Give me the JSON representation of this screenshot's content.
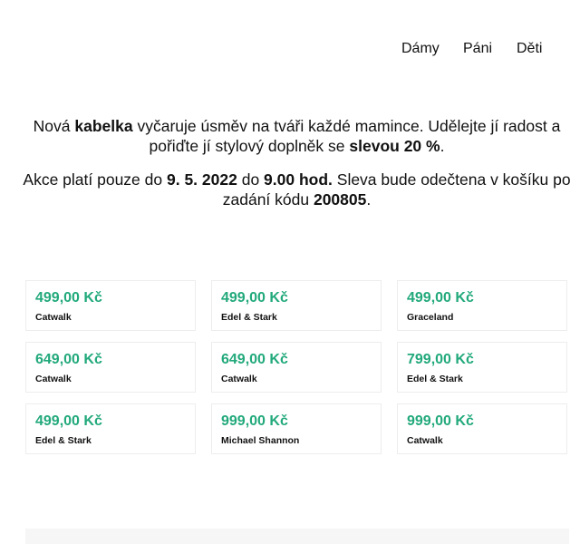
{
  "nav": {
    "items": [
      {
        "label": "Dámy"
      },
      {
        "label": "Páni"
      },
      {
        "label": "Děti"
      }
    ]
  },
  "promo": {
    "p1": {
      "t1": "Nová ",
      "b1": "kabelka",
      "t2": " vyčaruje úsměv na tváři každé mamince. Udělejte jí radost a pořiďte jí stylový doplněk se ",
      "b2": "slevou 20 %",
      "t3": "."
    },
    "p2": {
      "t1": "Akce platí pouze do ",
      "b1": "9. 5. 2022",
      "t2": " do ",
      "b2": "9.00 hod.",
      "t3": " Sleva bude odečtena v košíku po zadání kódu ",
      "b3": "200805",
      "t4": "."
    }
  },
  "products": [
    {
      "price": "499,00 Kč",
      "brand": "Catwalk"
    },
    {
      "price": "499,00 Kč",
      "brand": "Edel & Stark"
    },
    {
      "price": "499,00 Kč",
      "brand": "Graceland"
    },
    {
      "price": "649,00 Kč",
      "brand": "Catwalk"
    },
    {
      "price": "649,00 Kč",
      "brand": "Catwalk"
    },
    {
      "price": "799,00 Kč",
      "brand": "Edel & Stark"
    },
    {
      "price": "499,00 Kč",
      "brand": "Edel & Stark"
    },
    {
      "price": "999,00 Kč",
      "brand": "Michael Shannon"
    },
    {
      "price": "999,00 Kč",
      "brand": "Catwalk"
    }
  ],
  "colors": {
    "price": "#22a97b",
    "text": "#111111",
    "card_border": "#ededed",
    "footer_bg": "#f6f6f6"
  }
}
